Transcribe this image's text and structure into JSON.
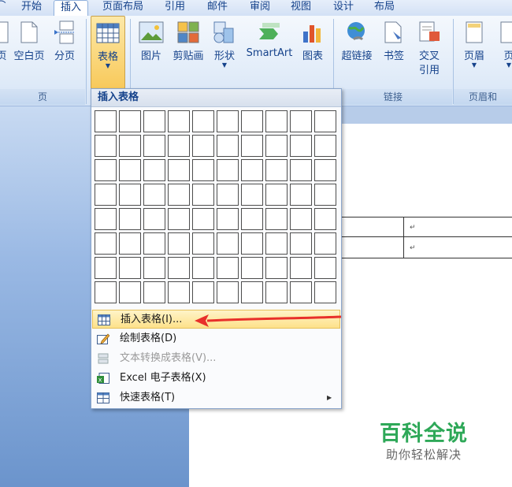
{
  "tabs": [
    "开始",
    "插入",
    "页面布局",
    "引用",
    "邮件",
    "审阅",
    "视图",
    "设计",
    "布局"
  ],
  "active_tab": "插入",
  "ribbon": {
    "pages_group": {
      "label": "页",
      "buttons": [
        "页",
        "空白页",
        "分页"
      ]
    },
    "table_group": {
      "button": "表格"
    },
    "illustrations": {
      "buttons": [
        "图片",
        "剪贴画",
        "形状",
        "SmartArt",
        "图表"
      ]
    },
    "links_group": {
      "label": "链接",
      "buttons": [
        "超链接",
        "书签",
        "交叉",
        "引用"
      ]
    },
    "header_group": {
      "label": "页眉和",
      "buttons": [
        "页眉",
        "页"
      ]
    }
  },
  "dropdown": {
    "title": "插入表格",
    "grid": {
      "columns": 10,
      "rows": 8
    },
    "items": [
      {
        "label": "插入表格(I)...",
        "icon": "table-icon",
        "highlighted": true
      },
      {
        "label": "绘制表格(D)",
        "icon": "pencil-table-icon"
      },
      {
        "label": "文本转换成表格(V)...",
        "icon": "convert-text-icon",
        "disabled": true
      },
      {
        "label": "Excel 电子表格(X)",
        "icon": "excel-icon"
      },
      {
        "label": "快速表格(T)",
        "icon": "quick-table-icon",
        "submenu": true
      }
    ]
  },
  "document": {
    "cell_marks": [
      "↵",
      "↵"
    ]
  },
  "watermark": {
    "title": "百科全说",
    "subtitle": "助你轻松解决"
  },
  "colors": {
    "accent": "#15428b",
    "highlight": "#fde18a",
    "watermark": "#2ea858",
    "arrow": "#e8302a"
  }
}
